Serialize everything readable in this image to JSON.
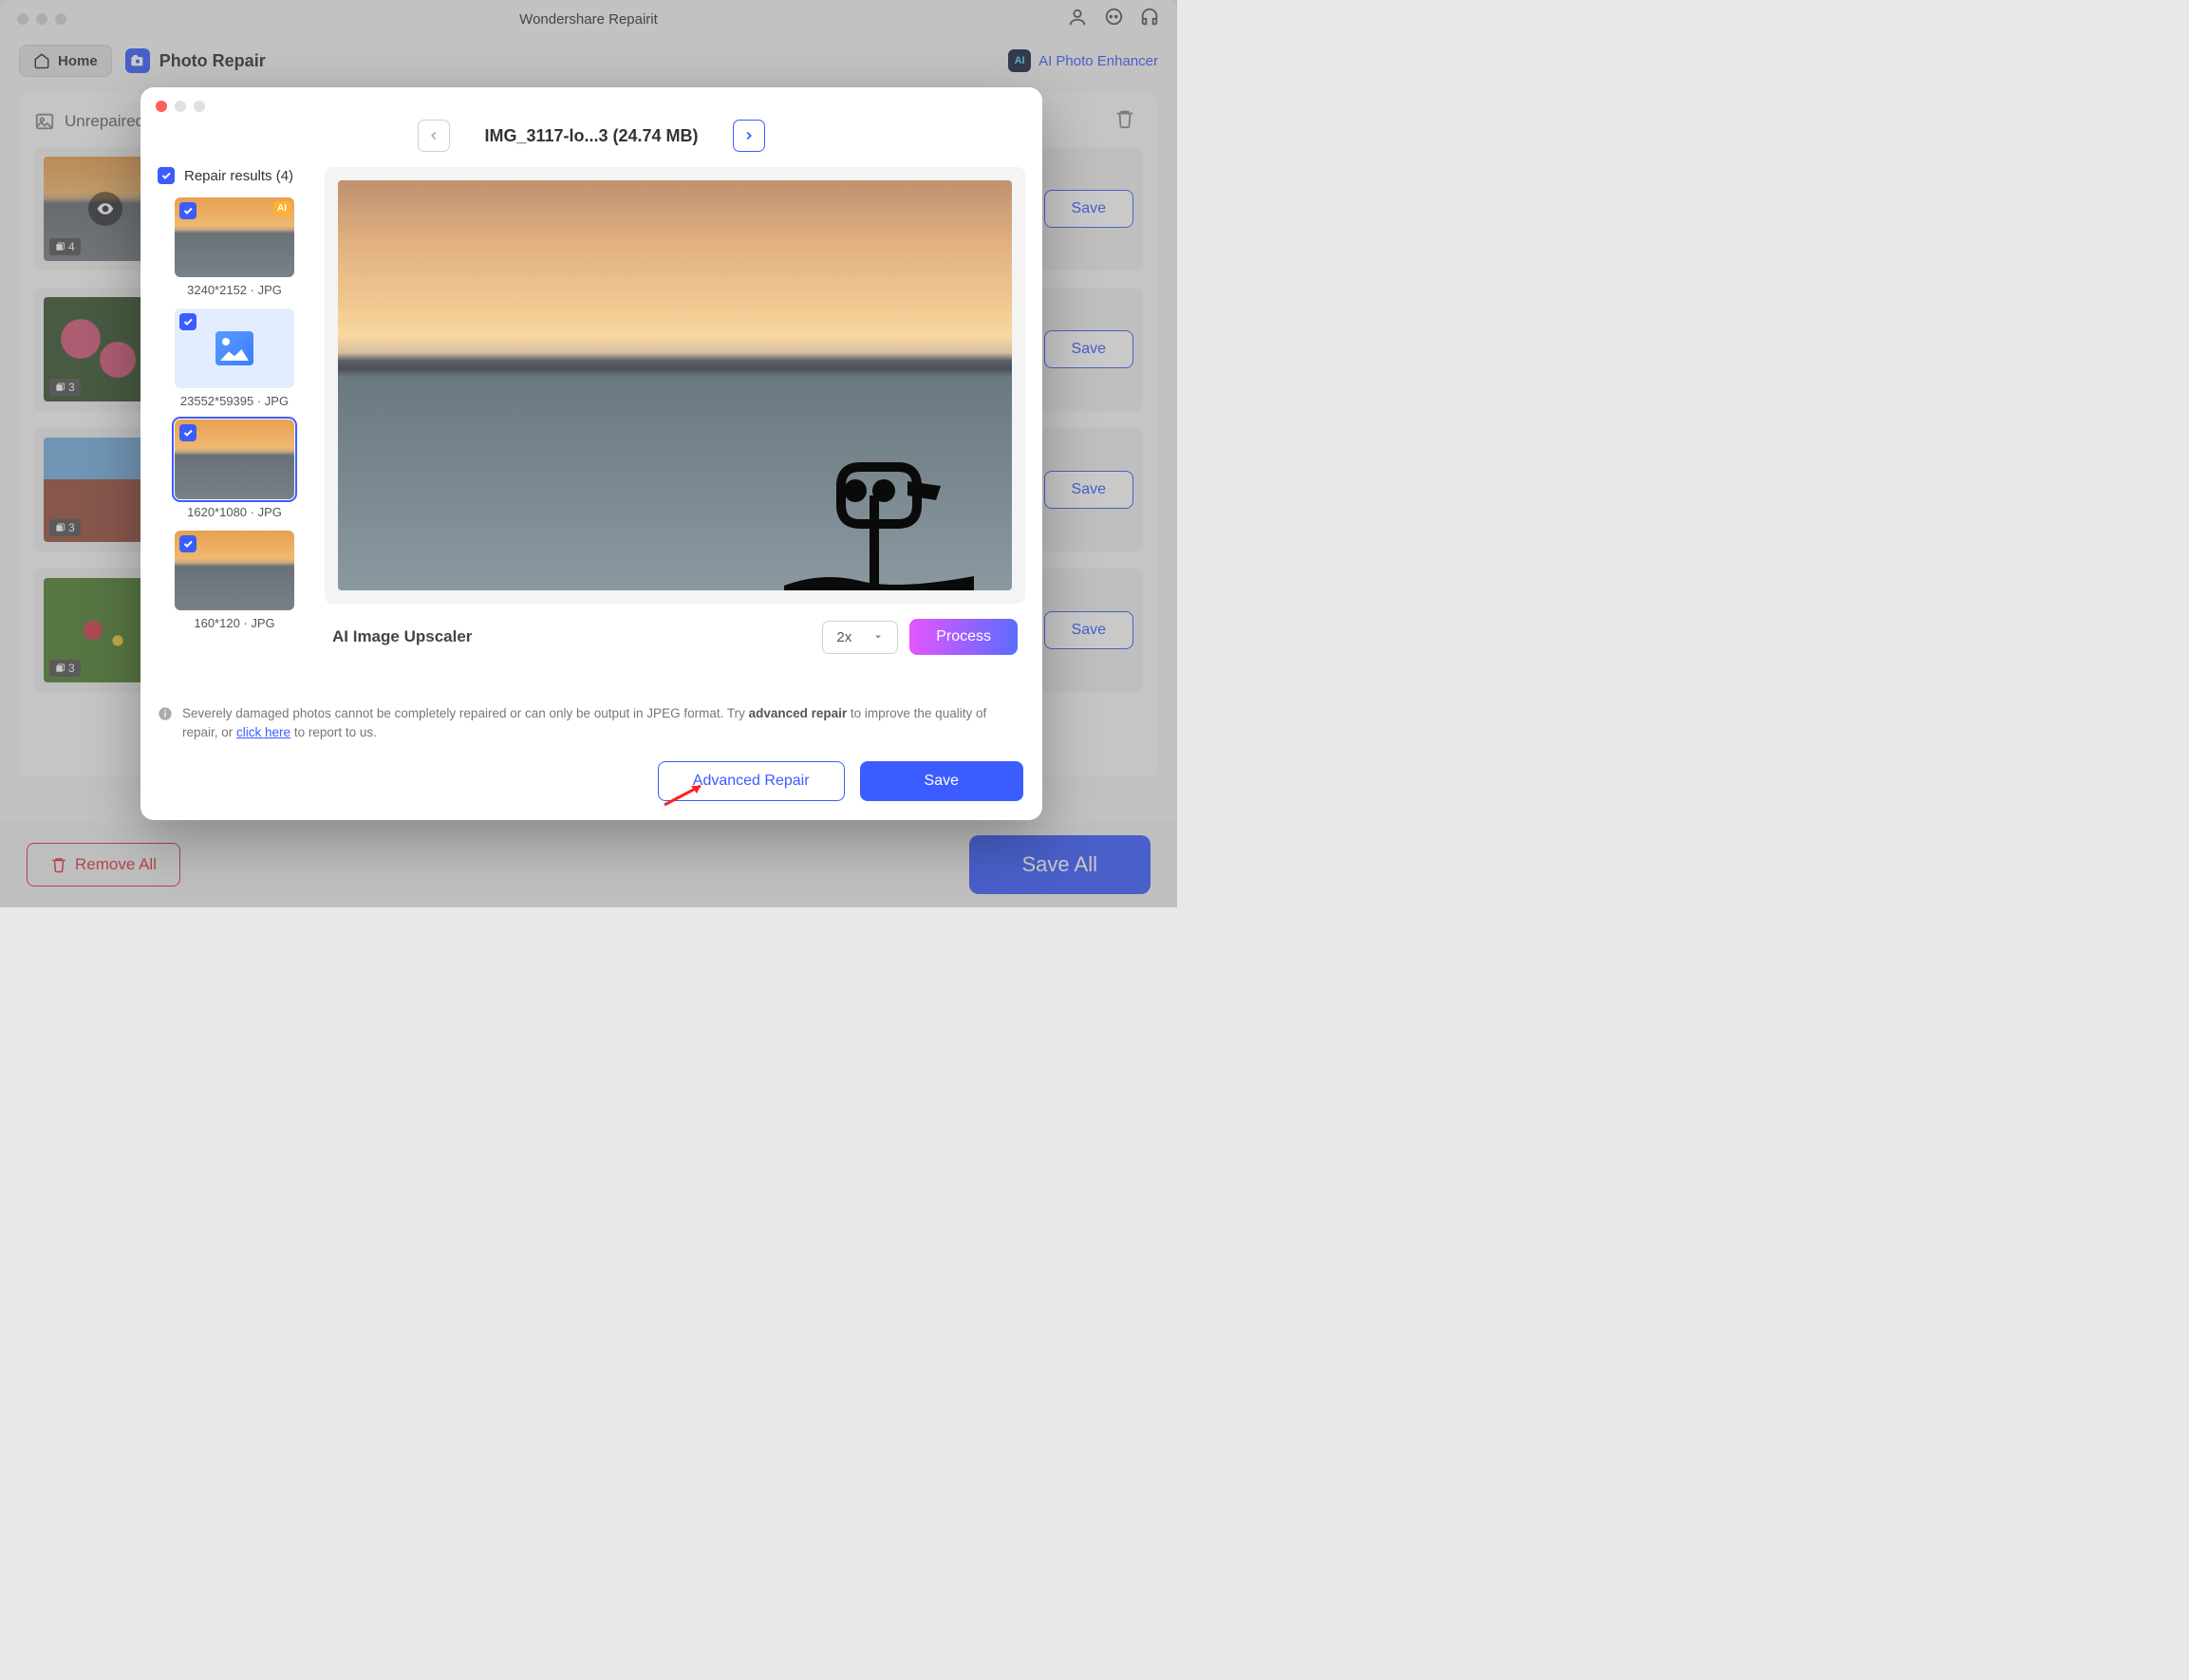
{
  "app": {
    "title": "Wondershare Repairit"
  },
  "topbar": {
    "home": "Home",
    "section": "Photo Repair",
    "enhancer": "AI Photo Enhancer",
    "enhancer_badge": "AI"
  },
  "panel": {
    "header": "Unrepaired",
    "rows": [
      {
        "count": "4",
        "save": "Save",
        "thumb": "sunset",
        "eye": true
      },
      {
        "count": "3",
        "save": "Save",
        "thumb": "flower"
      },
      {
        "count": "3",
        "save": "Save",
        "thumb": "building"
      },
      {
        "count": "3",
        "save": "Save",
        "thumb": "green"
      }
    ]
  },
  "bottom": {
    "remove_all": "Remove All",
    "save_all": "Save All"
  },
  "modal": {
    "title": "IMG_3117-lo...3 (24.74 MB)",
    "sidebar_title": "Repair results (4)",
    "results": [
      {
        "label": "3240*2152 · JPG",
        "type": "sunset",
        "ai": true
      },
      {
        "label": "23552*59395 · JPG",
        "type": "placeholder"
      },
      {
        "label": "1620*1080 · JPG",
        "type": "sunset",
        "selected": true
      },
      {
        "label": "160*120 · JPG",
        "type": "sunset"
      }
    ],
    "upscaler_label": "AI Image Upscaler",
    "upscaler_value": "2x",
    "process": "Process",
    "info_pre": "Severely damaged photos cannot be completely repaired or can only be output in JPEG format. Try ",
    "info_bold": "advanced repair",
    "info_mid": " to improve the quality of repair, or ",
    "info_link": "click here",
    "info_post": " to report to us.",
    "advanced": "Advanced Repair",
    "save": "Save"
  }
}
